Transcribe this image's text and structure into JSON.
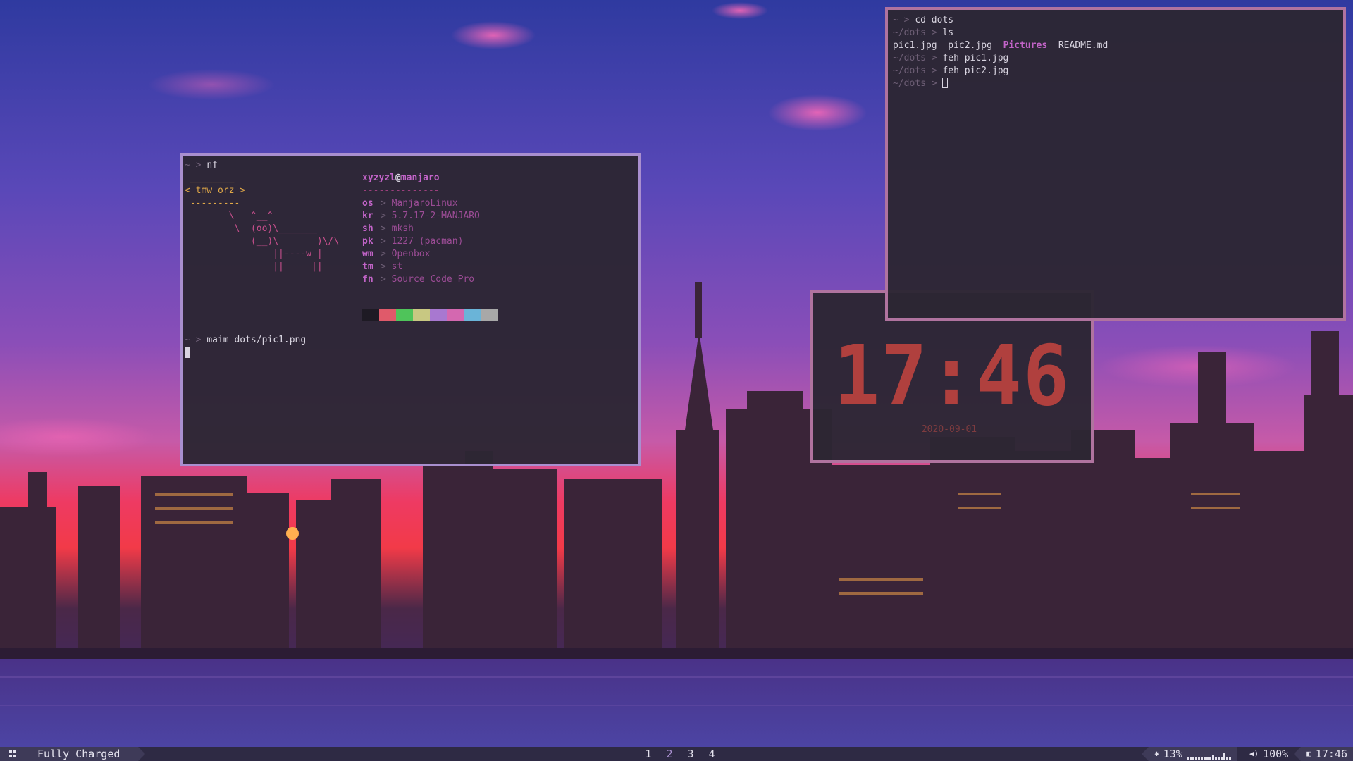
{
  "wallpaper": {
    "sky_top": "#3a3aa8",
    "sky_mid": "#a04aa8",
    "horizon": "#e8304a",
    "water": "#4a3a98"
  },
  "terminal_left": {
    "lines_top": [
      {
        "prompt": "~",
        "arrow": ">",
        "cmd": "nf"
      }
    ],
    "cowsay": {
      "bubble_top": " ________",
      "bubble_text": "< tmw orz >",
      "bubble_bottom": " ---------",
      "cow": [
        "        \\   ^__^",
        "         \\  (oo)\\_______",
        "            (__)\\       )\\/\\",
        "                ||----w |",
        "                ||     ||"
      ]
    },
    "neofetch": {
      "user": "xyzyzl",
      "at": "@",
      "host": "manjaro",
      "separator": "--------------",
      "fields": [
        {
          "key": "os",
          "value": "ManjaroLinux"
        },
        {
          "key": "kr",
          "value": "5.7.17-2-MANJARO"
        },
        {
          "key": "sh",
          "value": "mksh"
        },
        {
          "key": "pk",
          "value": "1227 (pacman)"
        },
        {
          "key": "wm",
          "value": "Openbox"
        },
        {
          "key": "tm",
          "value": "st"
        },
        {
          "key": "fn",
          "value": "Source Code Pro"
        }
      ],
      "palette": [
        "#1e1a24",
        "#e05a6a",
        "#4fc45a",
        "#c8c882",
        "#a878d0",
        "#d468b0",
        "#6ab4d8",
        "#a8a8a8"
      ]
    },
    "lines_bottom": [
      {
        "prompt": "~",
        "arrow": ">",
        "cmd": "maim dots/pic1.png"
      }
    ],
    "border_color": "#a98fcf"
  },
  "terminal_right": {
    "lines": [
      {
        "prompt": "~",
        "arrow": ">",
        "cmd": "cd dots"
      },
      {
        "prompt": "~/dots",
        "arrow": ">",
        "cmd": "ls"
      },
      {
        "prompt": "~/dots",
        "arrow": ">",
        "cmd": "feh pic1.jpg"
      },
      {
        "prompt": "~/dots",
        "arrow": ">",
        "cmd": "feh pic2.jpg"
      },
      {
        "prompt": "~/dots",
        "arrow": ">",
        "cmd": ""
      }
    ],
    "ls_output": [
      {
        "name": "pic1.jpg",
        "type": "file"
      },
      {
        "name": "pic2.jpg",
        "type": "file"
      },
      {
        "name": "Pictures",
        "type": "dir"
      },
      {
        "name": "README.md",
        "type": "file"
      }
    ],
    "border_color": "#b0739f"
  },
  "clock": {
    "time": "17:46",
    "date": "2020-09-01",
    "color": "#b0403e"
  },
  "bar": {
    "menu_icon": "grid-icon",
    "battery_status": "Fully Charged",
    "workspaces": [
      "1",
      "2",
      "3",
      "4"
    ],
    "active_workspace": "2",
    "cpu_icon": "cpu-icon",
    "cpu_percent": "13%",
    "volume_icon": "speaker-icon",
    "volume_percent": "100%",
    "clock_icon": "clock-icon",
    "time": "17:46",
    "accent": "#a98fcf"
  }
}
